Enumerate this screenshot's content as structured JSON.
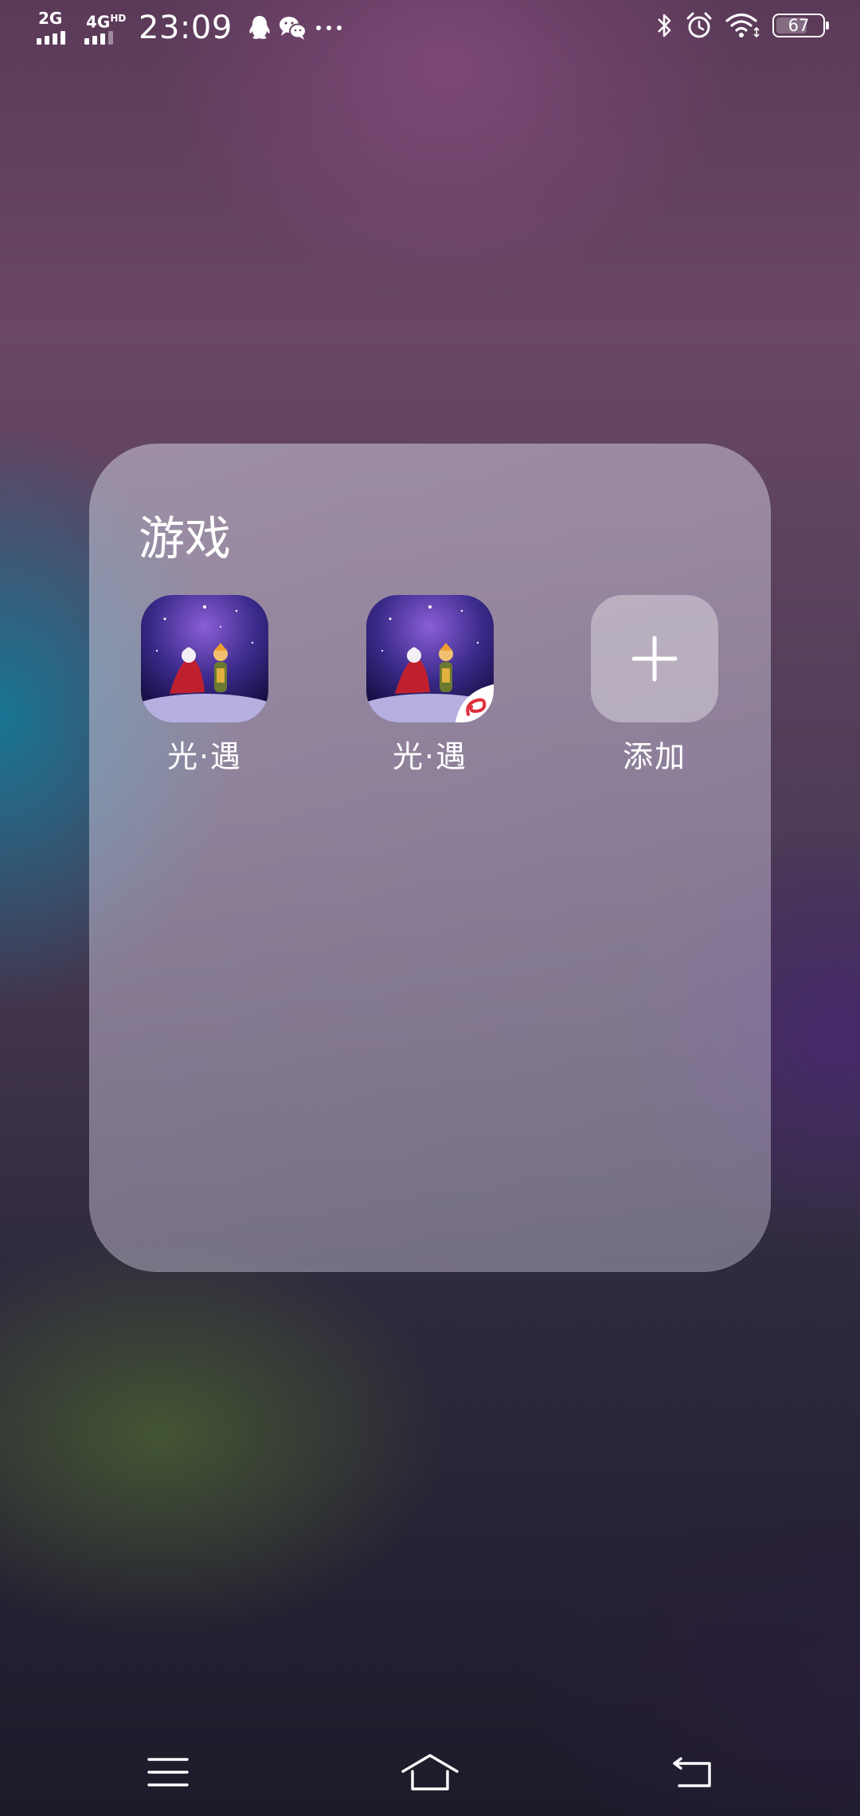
{
  "status_bar": {
    "sim1_label": "2G",
    "sim2_label": "4G",
    "sim2_hd": "HD",
    "time": "23:09",
    "notification_icons": [
      "qq-icon",
      "wechat-icon",
      "more-dots-icon"
    ],
    "right_icons": [
      "bluetooth-icon",
      "alarm-icon",
      "wifi-icon"
    ],
    "battery_level": "67",
    "battery_fraction": 0.67
  },
  "folder": {
    "title": "游戏",
    "apps": [
      {
        "label": "光·遇",
        "icon": "sky-game-icon"
      },
      {
        "label": "光·遇",
        "icon": "sky-game-netease-icon"
      }
    ],
    "add_label": "添加"
  },
  "nav_bar": {
    "buttons": [
      "menu-icon",
      "home-icon",
      "back-icon"
    ]
  }
}
